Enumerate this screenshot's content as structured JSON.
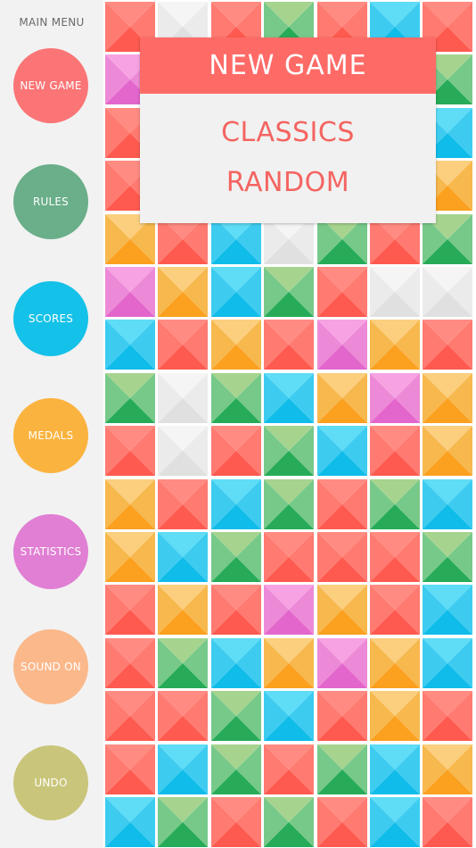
{
  "sidebar": {
    "title": "MAIN MENU",
    "buttons": [
      {
        "label": "NEW GAME",
        "color": "#fb7576"
      },
      {
        "label": "RULES",
        "color": "#6aae8a"
      },
      {
        "label": "SCORES",
        "color": "#14c1e8"
      },
      {
        "label": "MEDALS",
        "color": "#fbb33f"
      },
      {
        "label": "STATISTICS",
        "color": "#e07fd3"
      },
      {
        "label": "SOUND ON",
        "color": "#fbb88a"
      },
      {
        "label": "UNDO",
        "color": "#c9c57a"
      }
    ]
  },
  "popup": {
    "title": "NEW GAME",
    "options": [
      "CLASSICS",
      "RANDOM"
    ]
  },
  "palette": {
    "R": [
      "#ff8b82",
      "#fe5a4f",
      "#ff7a70"
    ],
    "G": [
      "#a6d48f",
      "#27ab58",
      "#77c98a"
    ],
    "B": [
      "#5fdcf6",
      "#10bce9",
      "#3dccf0"
    ],
    "O": [
      "#fbcf7e",
      "#fba01f",
      "#f7b84d"
    ],
    "P": [
      "#f7a3e3",
      "#e266cc",
      "#ed8ad7"
    ],
    "W": [
      "#f5f5f5",
      "#e0e0e0",
      "#ebebeb"
    ]
  },
  "board": {
    "rows": [
      [
        "R",
        "W",
        "R",
        "G",
        "R",
        "B",
        "R"
      ],
      [
        "P",
        "R",
        "B",
        "G",
        "R",
        "B",
        "G"
      ],
      [
        "R",
        "B",
        "G",
        "G",
        "R",
        "R",
        "B"
      ],
      [
        "R",
        "G",
        "B",
        "B",
        "G",
        "R",
        "O"
      ],
      [
        "O",
        "R",
        "B",
        "W",
        "G",
        "R",
        "G"
      ],
      [
        "P",
        "O",
        "B",
        "G",
        "R",
        "W",
        "W"
      ],
      [
        "B",
        "R",
        "O",
        "R",
        "P",
        "O",
        "R"
      ],
      [
        "G",
        "W",
        "G",
        "B",
        "O",
        "P",
        "O"
      ],
      [
        "R",
        "W",
        "R",
        "G",
        "B",
        "R",
        "O"
      ],
      [
        "O",
        "R",
        "B",
        "G",
        "R",
        "G",
        "B"
      ],
      [
        "O",
        "B",
        "G",
        "R",
        "R",
        "R",
        "G"
      ],
      [
        "R",
        "O",
        "R",
        "P",
        "O",
        "R",
        "B"
      ],
      [
        "R",
        "G",
        "B",
        "O",
        "P",
        "O",
        "B"
      ],
      [
        "R",
        "R",
        "G",
        "B",
        "R",
        "O",
        "R"
      ],
      [
        "R",
        "B",
        "G",
        "R",
        "G",
        "B",
        "O"
      ],
      [
        "B",
        "G",
        "R",
        "G",
        "R",
        "B",
        "R"
      ]
    ]
  }
}
